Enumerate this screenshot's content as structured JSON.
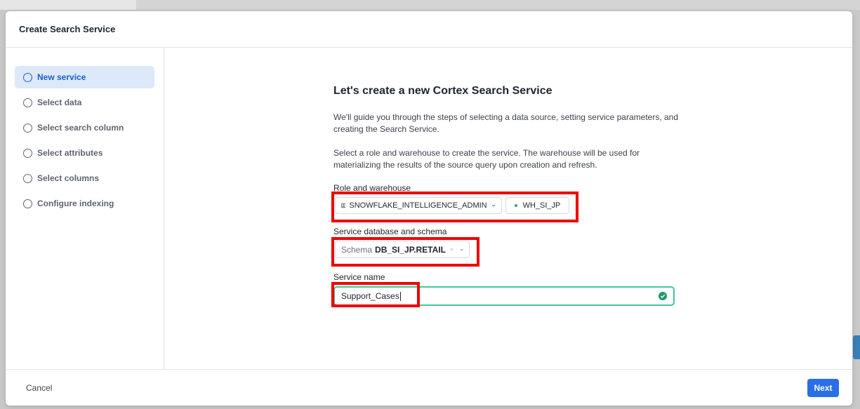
{
  "dialog": {
    "title": "Create Search Service"
  },
  "steps": [
    {
      "label": "New service",
      "active": true
    },
    {
      "label": "Select data",
      "active": false
    },
    {
      "label": "Select search column",
      "active": false
    },
    {
      "label": "Select attributes",
      "active": false
    },
    {
      "label": "Select columns",
      "active": false
    },
    {
      "label": "Configure indexing",
      "active": false
    }
  ],
  "main": {
    "heading": "Let's create a new Cortex Search Service",
    "intro": "We'll guide you through the steps of selecting a data source, setting service parameters, and creating the Search Service.",
    "instructions": "Select a role and warehouse to create the service. The warehouse will be used for materializing the results of the source query upon creation and refresh.",
    "role_warehouse": {
      "label": "Role and warehouse",
      "role": "SNOWFLAKE_INTELLIGENCE_ADMIN",
      "warehouse": "WH_SI_JP"
    },
    "schema": {
      "label": "Service database and schema",
      "prefix": "Schema",
      "value": "DB_SI_JP.RETAIL"
    },
    "service_name": {
      "label": "Service name",
      "value": "Support_Cases"
    }
  },
  "footer": {
    "cancel_label": "Cancel",
    "next_label": "Next"
  },
  "colors": {
    "accent": "#2a6ee8",
    "active_step_bg": "#dde8f9",
    "valid": "#43c99a",
    "highlight": "#ee0000"
  }
}
